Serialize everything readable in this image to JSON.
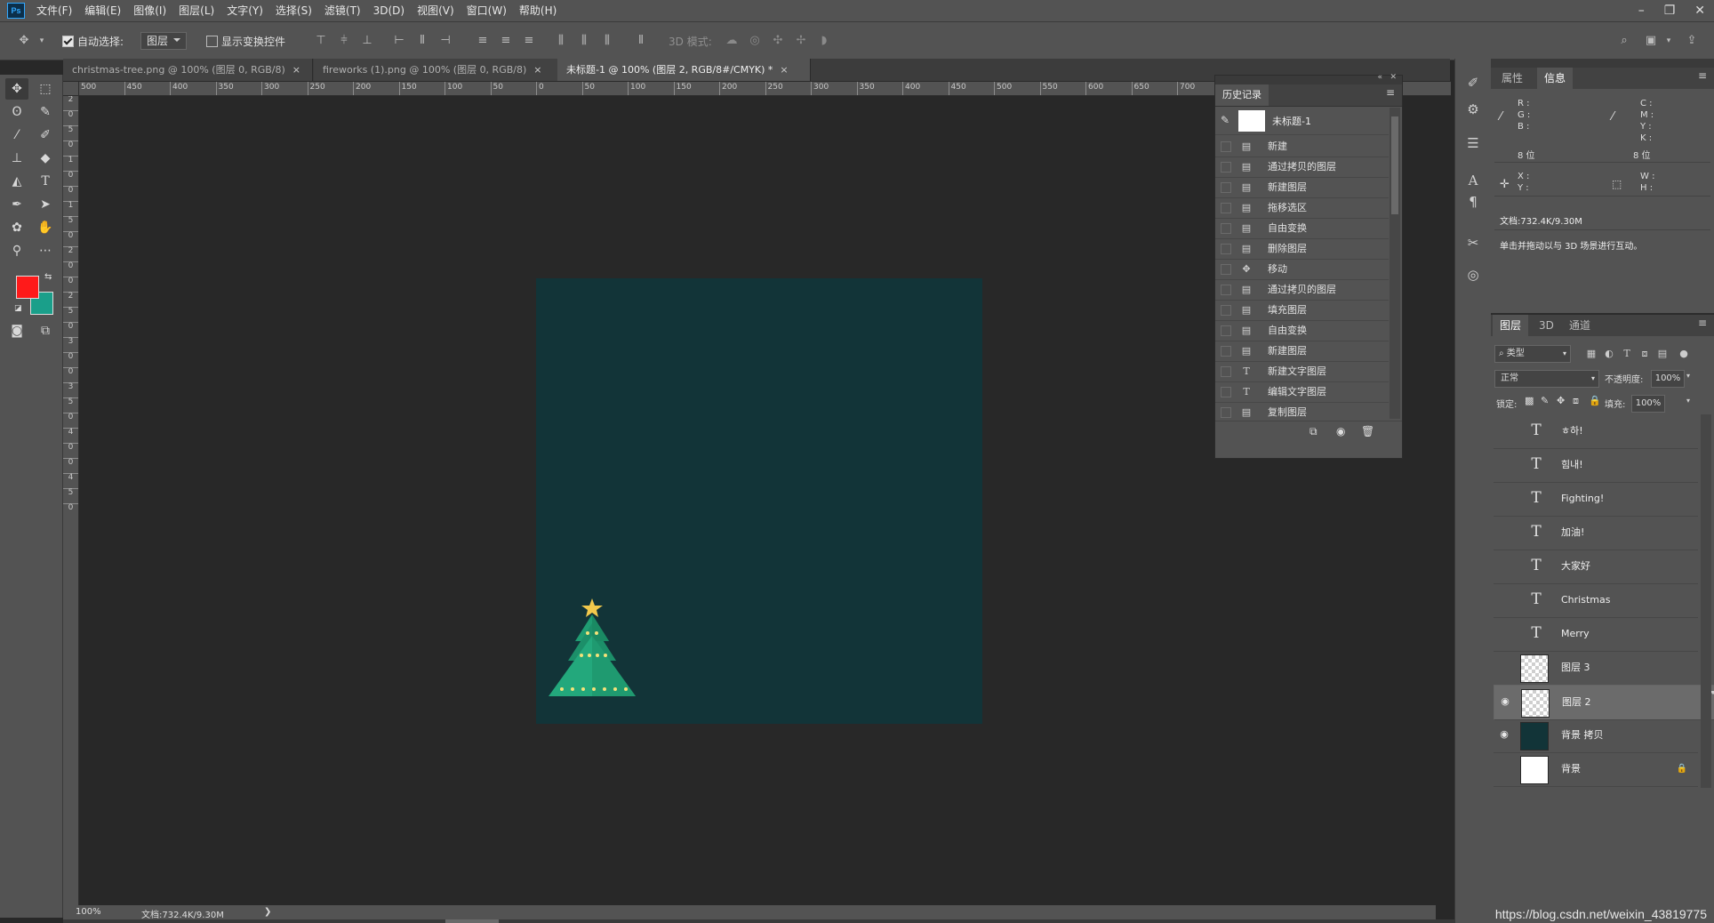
{
  "menubar": {
    "logo": "Ps",
    "items": [
      "文件(F)",
      "编辑(E)",
      "图像(I)",
      "图层(L)",
      "文字(Y)",
      "选择(S)",
      "滤镜(T)",
      "3D(D)",
      "视图(V)",
      "窗口(W)",
      "帮助(H)"
    ],
    "window_controls": [
      "–",
      "❐",
      "✕"
    ]
  },
  "options": {
    "auto_select_label": "自动选择:",
    "auto_select_value": "图层",
    "show_transform_label": "显示变换控件",
    "mode_3d_label": "3D 模式:"
  },
  "tabs": [
    {
      "label": "christmas-tree.png @ 100% (图层 0, RGB/8)",
      "close": "×"
    },
    {
      "label": "fireworks (1).png @ 100% (图层 0, RGB/8)",
      "close": "×"
    },
    {
      "label": "未标题-1 @ 100% (图层 2, RGB/8#/CMYK) *",
      "close": "×"
    }
  ],
  "ruler_top": [
    "500",
    "450",
    "400",
    "350",
    "300",
    "250",
    "200",
    "150",
    "100",
    "50",
    "0",
    "50",
    "100",
    "150",
    "200",
    "250",
    "300",
    "350",
    "400",
    "450",
    "500",
    "550",
    "600",
    "650",
    "700"
  ],
  "ruler_left": [
    "2",
    "0",
    "5",
    "0",
    "1",
    "0",
    "0",
    "1",
    "5",
    "0",
    "2",
    "0",
    "0",
    "2",
    "5",
    "0",
    "3",
    "0",
    "0",
    "3",
    "5",
    "0",
    "4",
    "0",
    "0",
    "4",
    "5",
    "0"
  ],
  "history": {
    "title": "历史记录",
    "snapshot": "未标题-1",
    "items": [
      {
        "label": "新建",
        "icon": "doc-icon"
      },
      {
        "label": "通过拷贝的图层",
        "icon": "doc-icon"
      },
      {
        "label": "新建图层",
        "icon": "doc-icon"
      },
      {
        "label": "拖移选区",
        "icon": "doc-icon"
      },
      {
        "label": "自由变换",
        "icon": "doc-icon"
      },
      {
        "label": "删除图层",
        "icon": "doc-icon"
      },
      {
        "label": "移动",
        "icon": "move-icon"
      },
      {
        "label": "通过拷贝的图层",
        "icon": "doc-icon"
      },
      {
        "label": "填充图层",
        "icon": "doc-icon"
      },
      {
        "label": "自由变换",
        "icon": "doc-icon"
      },
      {
        "label": "新建图层",
        "icon": "doc-icon"
      },
      {
        "label": "新建文字图层",
        "icon": "type-icon"
      },
      {
        "label": "编辑文字图层",
        "icon": "type-icon"
      },
      {
        "label": "复制图层",
        "icon": "doc-icon"
      }
    ]
  },
  "props": {
    "tab_props": "属性",
    "tab_info": "信息",
    "rgb": [
      "R :",
      "G :",
      "B :"
    ],
    "cmyk": [
      "C :",
      "M :",
      "Y :",
      "K :"
    ],
    "bit_left": "8 位",
    "bit_right": "8 位",
    "xy": [
      "X :",
      "Y :"
    ],
    "wh": [
      "W :",
      "H :"
    ],
    "doc_size": "文档:732.4K/9.30M",
    "hint": "单击并拖动以与 3D 场景进行互动。"
  },
  "layers": {
    "tab_layers": "图层",
    "tab_3d": "3D",
    "tab_channels": "通道",
    "filter_kind": "类型",
    "blend_mode": "正常",
    "opacity_label": "不透明度:",
    "opacity_value": "100%",
    "lock_label": "锁定:",
    "fill_label": "填充:",
    "fill_value": "100%",
    "items": [
      {
        "name": "ㅎ하!",
        "kind": "text",
        "visible": false
      },
      {
        "name": "힘내!",
        "kind": "text",
        "visible": false
      },
      {
        "name": "Fighting!",
        "kind": "text",
        "visible": false
      },
      {
        "name": "加油!",
        "kind": "text",
        "visible": false
      },
      {
        "name": "大家好",
        "kind": "text",
        "visible": false
      },
      {
        "name": "Christmas",
        "kind": "text",
        "visible": false
      },
      {
        "name": "Merry",
        "kind": "text",
        "visible": false
      },
      {
        "name": "图层 3",
        "kind": "pixel",
        "visible": false
      },
      {
        "name": "图层 2",
        "kind": "pixel",
        "visible": true,
        "selected": true
      },
      {
        "name": "背景 拷贝",
        "kind": "fill",
        "visible": true,
        "color": "#123438"
      },
      {
        "name": "背景",
        "kind": "white",
        "visible": false,
        "locked": true
      }
    ]
  },
  "status": {
    "zoom": "100%",
    "doc": "文档:732.4K/9.30M",
    "arrow": "❯"
  },
  "colors": {
    "foreground": "#ff1a1a",
    "background": "#1a9f8a",
    "document_bg": "#123438"
  },
  "watermark": "https://blog.csdn.net/weixin_43819775"
}
